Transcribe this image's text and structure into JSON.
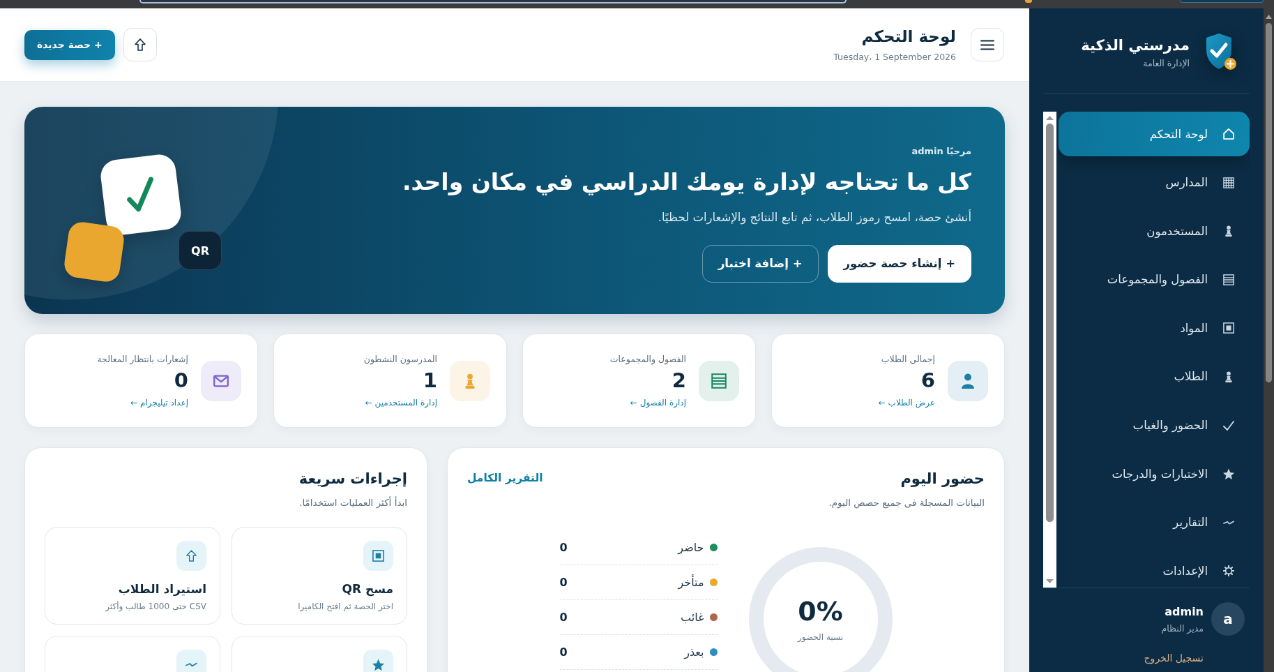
{
  "sidebar": {
    "brand": {
      "title": "مدرستي الذكية",
      "subtitle": "الإدارة العامة"
    },
    "nav_items": [
      {
        "label": "لوحة التحكم",
        "selected": true
      },
      {
        "label": "المدارس",
        "selected": false
      },
      {
        "label": "المستخدمون",
        "selected": false
      },
      {
        "label": "الفصول والمجموعات",
        "selected": false
      },
      {
        "label": "المواد",
        "selected": false
      },
      {
        "label": "الطلاب",
        "selected": false
      },
      {
        "label": "الحضور والغياب",
        "selected": false
      },
      {
        "label": "الاختبارات والدرجات",
        "selected": false
      },
      {
        "label": "التقارير",
        "selected": false
      },
      {
        "label": "الإعدادات",
        "selected": false
      }
    ],
    "user": {
      "avatar": "a",
      "name": "admin",
      "role": "مدير النظام"
    },
    "logout": "تسجيل الخروج"
  },
  "header": {
    "title": "لوحة التحكم",
    "date": "Tuesday، 1 September 2026",
    "new_button": "+ حصة جديدة"
  },
  "hero": {
    "greeting": "مرحبًا admin",
    "headline": "كل ما تحتاجه لإدارة يومك الدراسي في مكان واحد.",
    "subtitle": "أنشئ حصة، امسح رموز الطلاب، ثم تابع النتائج والإشعارات لحظيًا.",
    "buttons": [
      {
        "kind": "primary",
        "label": "+ إنشاء حصة حضور"
      },
      {
        "kind": "outline",
        "label": "+ إضافة اختبار"
      }
    ],
    "badge": "QR"
  },
  "stats": [
    {
      "label": "إجمالي الطلاب",
      "value": "6",
      "link": "عرض الطلاب ←",
      "color": "#1b7fa6"
    },
    {
      "label": "الفصول والمجموعات",
      "value": "2",
      "link": "إدارة الفصول ←",
      "color": "#15875f"
    },
    {
      "label": "المدرسون النشطون",
      "value": "1",
      "link": "إدارة المستخدمين ←",
      "color": "#e9a830"
    },
    {
      "label": "إشعارات بانتظار المعالجة",
      "value": "0",
      "link": "إعداد تيليجرام ←",
      "color": "#7d5fd0"
    }
  ],
  "attendance": {
    "title": "حضور اليوم",
    "subtitle": "البيانات المسجلة في جميع حصص اليوم.",
    "link": "التقرير الكامل",
    "ring": {
      "value": "0%",
      "caption": "نسبة الحضور"
    },
    "legend": [
      {
        "label": "حاضر",
        "value": "0",
        "color": "#1a8f5f"
      },
      {
        "label": "متأخر",
        "value": "0",
        "color": "#e9a92f"
      },
      {
        "label": "غائب",
        "value": "0",
        "color": "#b0654e"
      },
      {
        "label": "بعذر",
        "value": "0",
        "color": "#2b8fbf"
      }
    ]
  },
  "quick_actions": {
    "title": "إجراءات سريعة",
    "subtitle": "ابدأ أكثر العمليات استخدامًا.",
    "items": [
      {
        "kind": "qr",
        "title": "مسح QR",
        "description": "اختر الحصة ثم افتح الكاميرا"
      },
      {
        "kind": "upload",
        "title": "استيراد الطلاب",
        "description": "CSV حتى 1000 طالب وأكثر"
      },
      {
        "kind": "star"
      },
      {
        "kind": "pulse"
      }
    ]
  }
}
